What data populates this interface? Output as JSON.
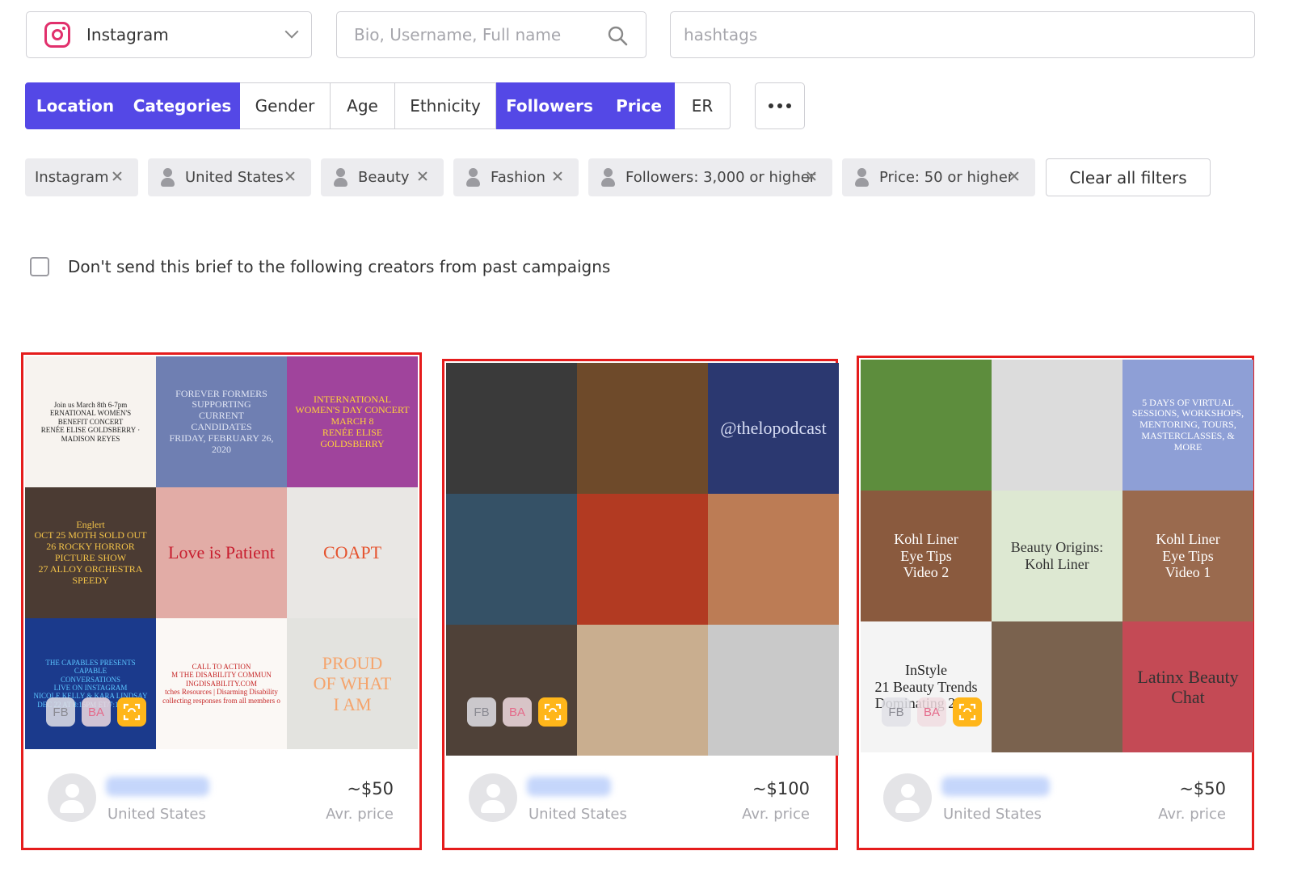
{
  "search": {
    "platform": "Instagram",
    "bio_placeholder": "Bio, Username, Full name",
    "hashtags_placeholder": "hashtags"
  },
  "filter_tabs": [
    {
      "label": "Location",
      "active": true
    },
    {
      "label": "Categories",
      "active": true
    },
    {
      "label": "Gender",
      "active": false
    },
    {
      "label": "Age",
      "active": false
    },
    {
      "label": "Ethnicity",
      "active": false
    },
    {
      "label": "Followers",
      "active": true
    },
    {
      "label": "Price",
      "active": true
    },
    {
      "label": "ER",
      "active": false
    }
  ],
  "chips": [
    {
      "label": "Instagram",
      "icon": "none"
    },
    {
      "label": "United States",
      "icon": "user-icon"
    },
    {
      "label": "Beauty",
      "icon": "user-icon"
    },
    {
      "label": "Fashion",
      "icon": "user-icon"
    },
    {
      "label": "Followers: 3,000 or higher",
      "icon": "user-icon"
    },
    {
      "label": "Price: 50 or higher",
      "icon": "user-icon"
    }
  ],
  "clear_all_label": "Clear all filters",
  "exclude_label": "Don't send this brief to the following creators from past campaigns",
  "colors": {
    "accent": "#5448e6",
    "highlight_border": "#e51c1c",
    "scan_badge": "#ffb61a"
  },
  "badges": {
    "fb": "FB",
    "ba": "BA"
  },
  "creators": [
    {
      "location": "United States",
      "price": "~$50",
      "price_label": "Avr. price",
      "tiles": [
        {
          "text": "Join us March 8th 6-7pm\nERNATIONAL WOMEN'S\nBENEFIT CONCERT\nRENÉE ELISE GOLDSBERRY · MADISON REYES",
          "bg": "#f7f3ef",
          "fg": "#222"
        },
        {
          "text": "FOREVER FORMERS\nSUPPORTING\nCURRENT\nCANDIDATES\nFRIDAY, FEBRUARY 26, 2020",
          "bg": "#6f7fb2",
          "fg": "#dfe4f3"
        },
        {
          "text": "INTERNATIONAL\nWOMEN'S DAY CONCERT\nMARCH 8\nRENÉE ELISE GOLDSBERRY",
          "bg": "#a0449c",
          "fg": "#ffd23a"
        },
        {
          "text": "Englert\nOCT 25 MOTH SOLD OUT\n26 ROCKY HORROR PICTURE SHOW\n27 ALLOY ORCHESTRA SPEEDY",
          "bg": "#4b3b33",
          "fg": "#f3c349"
        },
        {
          "text": "Love is Patient",
          "bg": "#e2aca6",
          "fg": "#c81e2f"
        },
        {
          "text": "COAPT",
          "bg": "#e9e7e4",
          "fg": "#e5532e"
        },
        {
          "text": "THE CAPABLES PRESENTS\nCAPABLE\nCONVERSATIONS\nLIVE ON INSTAGRAM\nNICOLE KELLY & KARA LINDSAY\nDEC 22 AT 8:15PM ET/7:15PM CT",
          "bg": "#1b3a8c",
          "fg": "#5cc6ff"
        },
        {
          "text": "CALL TO ACTION\nM THE DISABILITY COMMUN\nINGDISABILITY.COM\ntches Resources | Disarming Disability\ncollecting responses from all members o",
          "bg": "#fbf8f5",
          "fg": "#c62828"
        },
        {
          "text": "PROUD\nOF WHAT\nI AM",
          "bg": "#e3e3df",
          "fg": "#f5a46c"
        }
      ]
    },
    {
      "location": "United States",
      "price": "~$100",
      "price_label": "Avr. price",
      "tiles": [
        {
          "text": "",
          "bg": "#3a3a3a",
          "fg": "#fff"
        },
        {
          "text": "",
          "bg": "#6e4a2a",
          "fg": "#fff"
        },
        {
          "text": "@thelopodcast",
          "bg": "#2b3870",
          "fg": "#d8def5"
        },
        {
          "text": "",
          "bg": "#355166",
          "fg": "#fff"
        },
        {
          "text": "",
          "bg": "#b23a22",
          "fg": "#fff"
        },
        {
          "text": "",
          "bg": "#bc7c55",
          "fg": "#fff"
        },
        {
          "text": "",
          "bg": "#4f4138",
          "fg": "#fff"
        },
        {
          "text": "",
          "bg": "#c9ae8f",
          "fg": "#fff"
        },
        {
          "text": "",
          "bg": "#c9c9c9",
          "fg": "#fff"
        }
      ]
    },
    {
      "location": "United States",
      "price": "~$50",
      "price_label": "Avr. price",
      "tiles": [
        {
          "text": "",
          "bg": "#5d8d3d",
          "fg": "#fff"
        },
        {
          "text": "",
          "bg": "#dcdcdc",
          "fg": "#222"
        },
        {
          "text": "5 DAYS OF VIRTUAL SESSIONS, WORKSHOPS, MENTORING, TOURS, MASTERCLASSES, & MORE",
          "bg": "#8e9fd6",
          "fg": "#fff"
        },
        {
          "text": "Kohl Liner\nEye Tips\nVideo 2",
          "bg": "#8a5a3e",
          "fg": "#ffffff"
        },
        {
          "text": "Beauty Origins: Kohl Liner",
          "bg": "#dde8d2",
          "fg": "#333"
        },
        {
          "text": "Kohl Liner\nEye Tips\nVideo 1",
          "bg": "#9a6a4e",
          "fg": "#ffffff"
        },
        {
          "text": "InStyle\n21 Beauty Trends\nDominating 2021",
          "bg": "#f4f4f4",
          "fg": "#222"
        },
        {
          "text": "",
          "bg": "#7a624e",
          "fg": "#fff"
        },
        {
          "text": "Latinx Beauty Chat",
          "bg": "#c44a55",
          "fg": "#333"
        }
      ]
    }
  ]
}
